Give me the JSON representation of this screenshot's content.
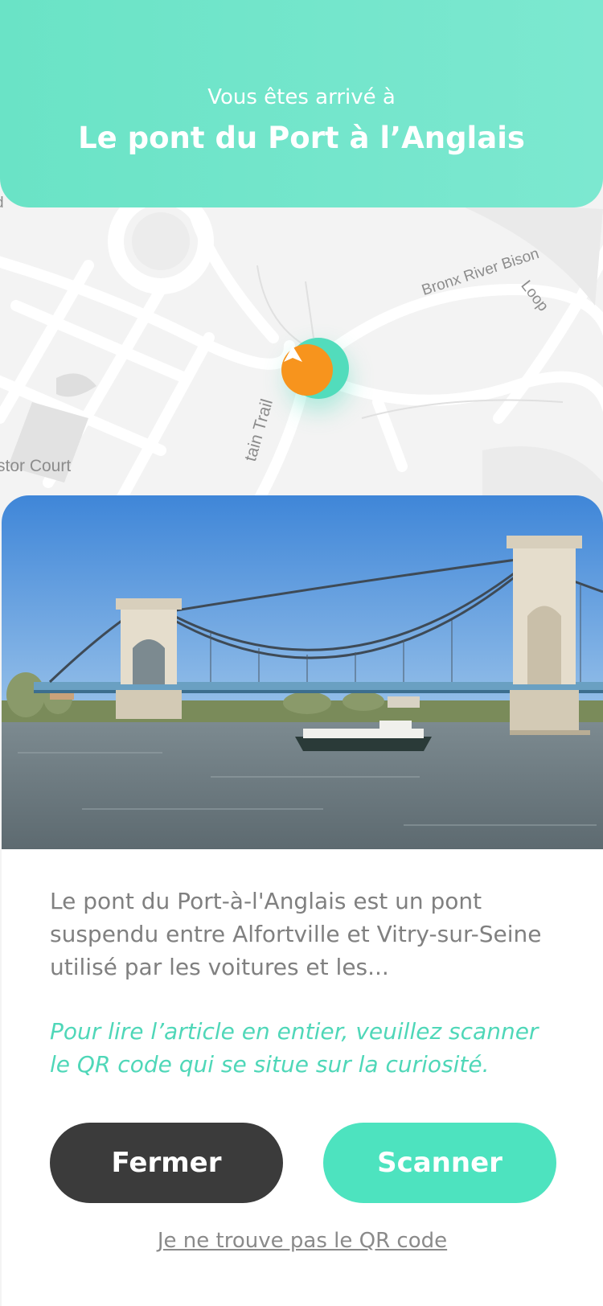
{
  "header": {
    "subtitle": "Vous êtes arrivé à",
    "title": "Le pont du Port à l’Anglais"
  },
  "map": {
    "labels": {
      "astor": "stor Court",
      "trail": "tain Trail",
      "bronx": "Bronx River Bison",
      "loop": "Loop",
      "top_left": "d"
    }
  },
  "card": {
    "description": "Le pont du Port-à-l'Anglais est un pont suspendu entre Alfortville et Vitry-sur-Seine utilisé par les voitures et les...",
    "cta_text": "Pour lire l’article en entier, veuillez scanner le QR code qui se situe sur la curiosité.",
    "buttons": {
      "close_label": "Fermer",
      "scan_label": "Scanner"
    },
    "help_link": "Je ne trouve pas le QR code"
  },
  "colors": {
    "accent": "#4de3bf",
    "banner": "#6ae3c6",
    "marker": "#f7941d",
    "dark_button": "#3b3b3b"
  }
}
